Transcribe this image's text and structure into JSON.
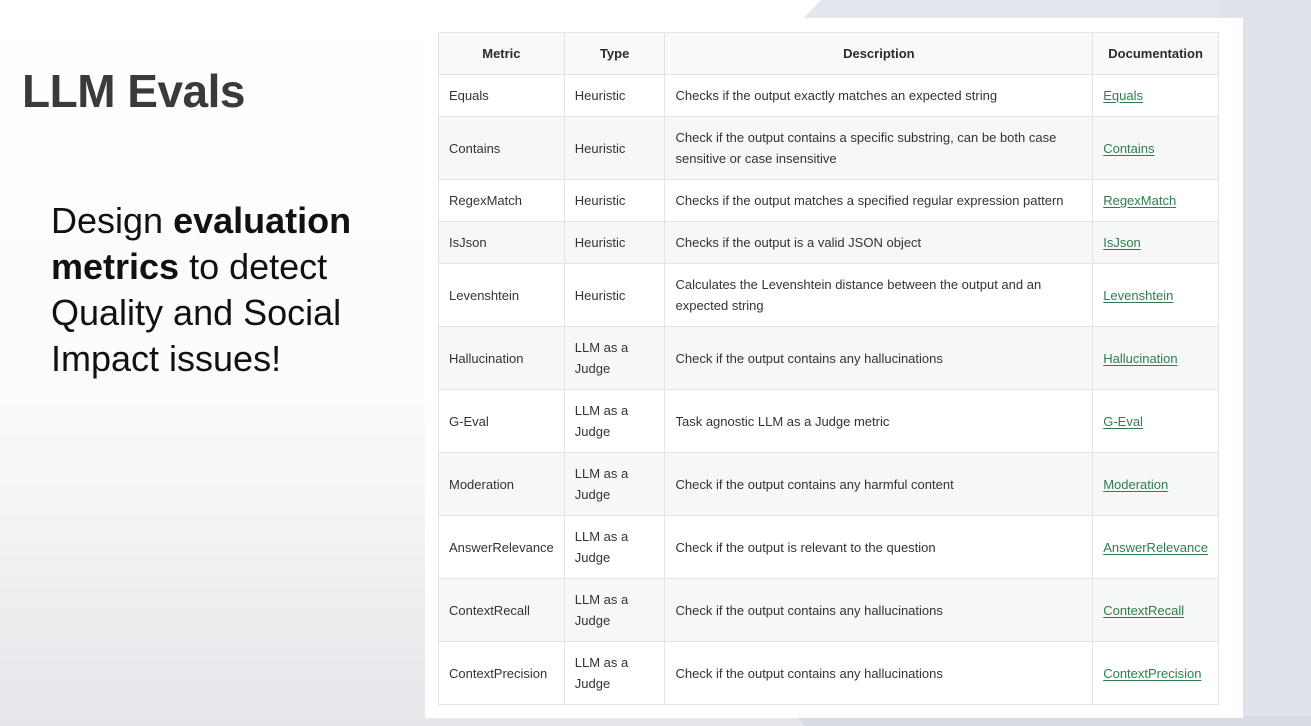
{
  "slide": {
    "title": "LLM Evals",
    "subtitle": {
      "part1": "Design ",
      "bold": "evaluation metrics",
      "part2": " to detect Quality and Social Impact issues!"
    }
  },
  "table": {
    "headers": [
      "Metric",
      "Type",
      "Description",
      "Documentation"
    ],
    "rows": [
      {
        "metric": "Equals",
        "type": "Heuristic",
        "description": "Checks if the output exactly matches an expected string",
        "doc": "Equals"
      },
      {
        "metric": "Contains",
        "type": "Heuristic",
        "description": "Check if the output contains a specific substring, can be both case sensitive or case insensitive",
        "doc": "Contains"
      },
      {
        "metric": "RegexMatch",
        "type": "Heuristic",
        "description": "Checks if the output matches a specified regular expression pattern",
        "doc": "RegexMatch"
      },
      {
        "metric": "IsJson",
        "type": "Heuristic",
        "description": "Checks if the output is a valid JSON object",
        "doc": "IsJson"
      },
      {
        "metric": "Levenshtein",
        "type": "Heuristic",
        "description": "Calculates the Levenshtein distance between the output and an expected string",
        "doc": "Levenshtein"
      },
      {
        "metric": "Hallucination",
        "type": "LLM as a Judge",
        "description": "Check if the output contains any hallucinations",
        "doc": "Hallucination"
      },
      {
        "metric": "G-Eval",
        "type": "LLM as a Judge",
        "description": "Task agnostic LLM as a Judge metric",
        "doc": "G-Eval"
      },
      {
        "metric": "Moderation",
        "type": "LLM as a Judge",
        "description": "Check if the output contains any harmful content",
        "doc": "Moderation"
      },
      {
        "metric": "AnswerRelevance",
        "type": "LLM as a Judge",
        "description": "Check if the output is relevant to the question",
        "doc": "AnswerRelevance"
      },
      {
        "metric": "ContextRecall",
        "type": "LLM as a Judge",
        "description": "Check if the output contains any hallucinations",
        "doc": "ContextRecall"
      },
      {
        "metric": "ContextPrecision",
        "type": "LLM as a Judge",
        "description": "Check if the output contains any hallucinations",
        "doc": "ContextPrecision"
      }
    ]
  },
  "colors": {
    "link": "#2e7d4f",
    "title": "#3a3a3c",
    "border": "#e2e4e8"
  }
}
